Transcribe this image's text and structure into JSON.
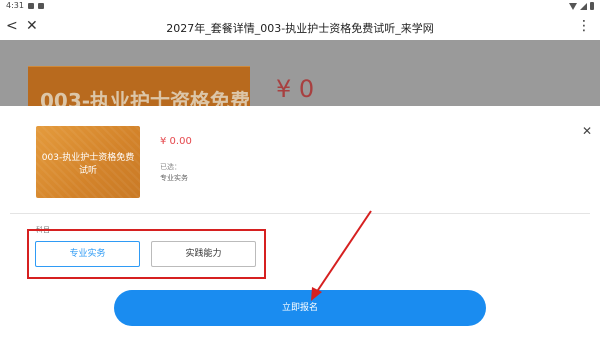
{
  "status_bar": {
    "time": "4:31"
  },
  "title_bar": {
    "back_glyph": "<",
    "close_glyph": "✕",
    "title": "2027年_套餐详情_003-执业护士资格免费试听_来学网",
    "more_glyph": "⋮"
  },
  "background_page": {
    "cover_text": "003-执业护士资格免费",
    "price_text": "¥ 0"
  },
  "sheet": {
    "close_glyph": "✕",
    "cover_title": "003-执业护士资格免费试听",
    "price": "¥ 0.00",
    "selected_label": "已选：",
    "selected_value": "专业实务",
    "option_group_label": "科目",
    "options": [
      {
        "label": "专业实务",
        "selected": true
      },
      {
        "label": "实践能力",
        "selected": false
      }
    ],
    "signup_label": "立即报名"
  },
  "colors": {
    "accent": "#1a8cf0",
    "price": "#e5484d",
    "highlight": "#d62020",
    "cover": "#d3832a"
  }
}
